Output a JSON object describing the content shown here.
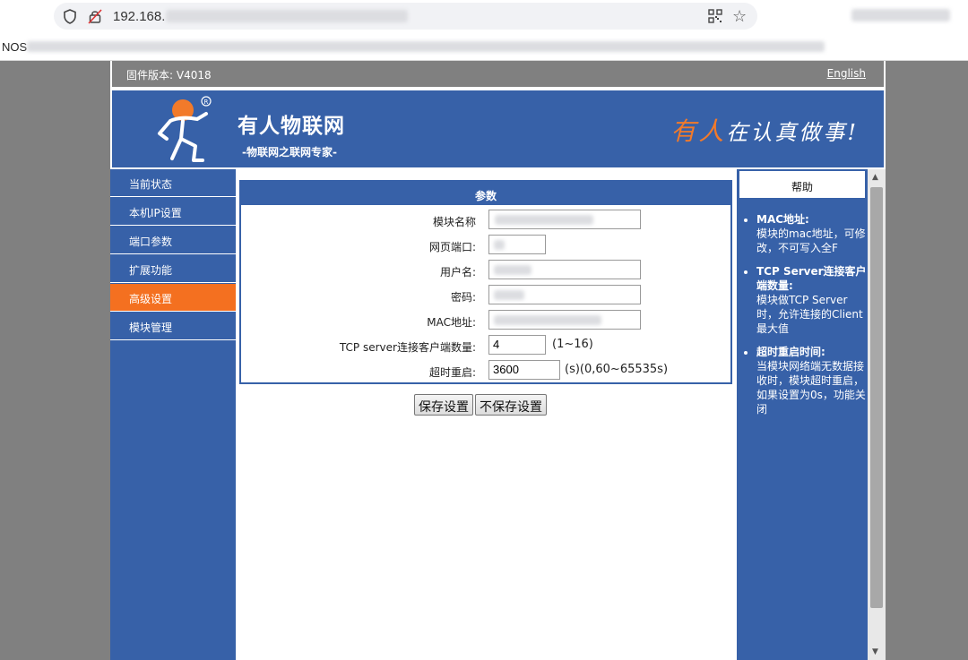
{
  "browser": {
    "url": "192.168.",
    "bookmark_text": "NOS"
  },
  "header": {
    "firmware": "固件版本: V4018",
    "language_link": "English",
    "brand_name": "有人物联网",
    "brand_sub": "-物联网之联网专家-",
    "slogan_highlight": "有人",
    "slogan_rest": "在认真做事!"
  },
  "sidebar": {
    "items": [
      {
        "label": "当前状态"
      },
      {
        "label": "本机IP设置"
      },
      {
        "label": "端口参数"
      },
      {
        "label": "扩展功能"
      },
      {
        "label": "高级设置"
      },
      {
        "label": "模块管理"
      }
    ],
    "active_index": 4
  },
  "form": {
    "panel_title": "参数",
    "fields": [
      {
        "label": "模块名称",
        "value": "",
        "masked": true
      },
      {
        "label": "网页端口:",
        "value": "",
        "masked": true
      },
      {
        "label": "用户名:",
        "value": "",
        "masked": true
      },
      {
        "label": "密码:",
        "value": "",
        "masked": true
      },
      {
        "label": "MAC地址:",
        "value": "",
        "masked": true
      },
      {
        "label": "TCP server连接客户端数量:",
        "value": "4",
        "note": "(1~16)"
      },
      {
        "label": "超时重启:",
        "value": "3600",
        "note": "(s)(0,60~65535s)"
      }
    ],
    "save_label": "保存设置",
    "cancel_label": "不保存设置"
  },
  "help": {
    "title": "帮助",
    "items": [
      {
        "title": "MAC地址:",
        "body": "模块的mac地址，可修改，不可写入全F"
      },
      {
        "title": "TCP Server连接客户端数量:",
        "body": "模块做TCP Server时，允许连接的Client最大值"
      },
      {
        "title": "超时重启时间:",
        "body": "当模块网络端无数据接收时，模块超时重启，如果设置为0s，功能关闭"
      }
    ]
  },
  "colors": {
    "brand_blue": "#3761a8",
    "active_orange": "#f47020",
    "page_gray": "#808080"
  }
}
